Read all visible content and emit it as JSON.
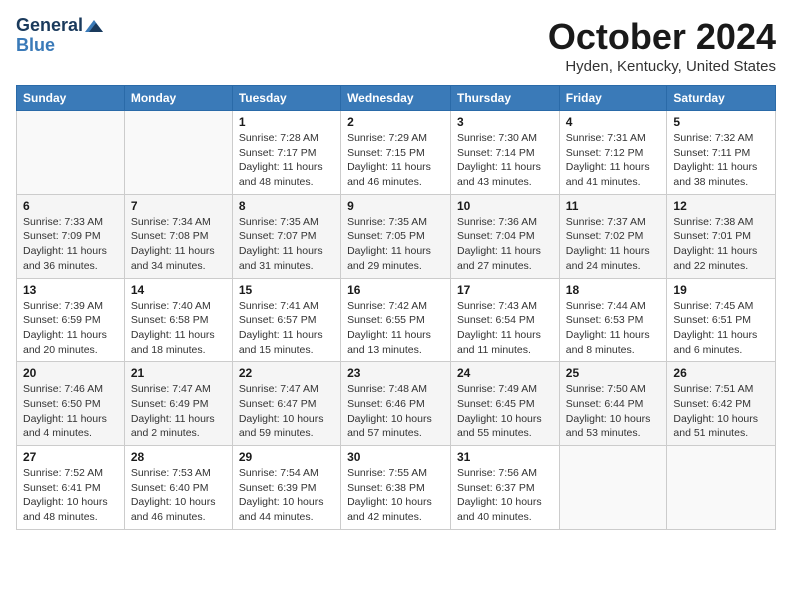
{
  "header": {
    "logo_line1": "General",
    "logo_line2": "Blue",
    "month_title": "October 2024",
    "location": "Hyden, Kentucky, United States"
  },
  "weekdays": [
    "Sunday",
    "Monday",
    "Tuesday",
    "Wednesday",
    "Thursday",
    "Friday",
    "Saturday"
  ],
  "weeks": [
    [
      {
        "day": "",
        "sunrise": "",
        "sunset": "",
        "daylight": ""
      },
      {
        "day": "",
        "sunrise": "",
        "sunset": "",
        "daylight": ""
      },
      {
        "day": "1",
        "sunrise": "Sunrise: 7:28 AM",
        "sunset": "Sunset: 7:17 PM",
        "daylight": "Daylight: 11 hours and 48 minutes."
      },
      {
        "day": "2",
        "sunrise": "Sunrise: 7:29 AM",
        "sunset": "Sunset: 7:15 PM",
        "daylight": "Daylight: 11 hours and 46 minutes."
      },
      {
        "day": "3",
        "sunrise": "Sunrise: 7:30 AM",
        "sunset": "Sunset: 7:14 PM",
        "daylight": "Daylight: 11 hours and 43 minutes."
      },
      {
        "day": "4",
        "sunrise": "Sunrise: 7:31 AM",
        "sunset": "Sunset: 7:12 PM",
        "daylight": "Daylight: 11 hours and 41 minutes."
      },
      {
        "day": "5",
        "sunrise": "Sunrise: 7:32 AM",
        "sunset": "Sunset: 7:11 PM",
        "daylight": "Daylight: 11 hours and 38 minutes."
      }
    ],
    [
      {
        "day": "6",
        "sunrise": "Sunrise: 7:33 AM",
        "sunset": "Sunset: 7:09 PM",
        "daylight": "Daylight: 11 hours and 36 minutes."
      },
      {
        "day": "7",
        "sunrise": "Sunrise: 7:34 AM",
        "sunset": "Sunset: 7:08 PM",
        "daylight": "Daylight: 11 hours and 34 minutes."
      },
      {
        "day": "8",
        "sunrise": "Sunrise: 7:35 AM",
        "sunset": "Sunset: 7:07 PM",
        "daylight": "Daylight: 11 hours and 31 minutes."
      },
      {
        "day": "9",
        "sunrise": "Sunrise: 7:35 AM",
        "sunset": "Sunset: 7:05 PM",
        "daylight": "Daylight: 11 hours and 29 minutes."
      },
      {
        "day": "10",
        "sunrise": "Sunrise: 7:36 AM",
        "sunset": "Sunset: 7:04 PM",
        "daylight": "Daylight: 11 hours and 27 minutes."
      },
      {
        "day": "11",
        "sunrise": "Sunrise: 7:37 AM",
        "sunset": "Sunset: 7:02 PM",
        "daylight": "Daylight: 11 hours and 24 minutes."
      },
      {
        "day": "12",
        "sunrise": "Sunrise: 7:38 AM",
        "sunset": "Sunset: 7:01 PM",
        "daylight": "Daylight: 11 hours and 22 minutes."
      }
    ],
    [
      {
        "day": "13",
        "sunrise": "Sunrise: 7:39 AM",
        "sunset": "Sunset: 6:59 PM",
        "daylight": "Daylight: 11 hours and 20 minutes."
      },
      {
        "day": "14",
        "sunrise": "Sunrise: 7:40 AM",
        "sunset": "Sunset: 6:58 PM",
        "daylight": "Daylight: 11 hours and 18 minutes."
      },
      {
        "day": "15",
        "sunrise": "Sunrise: 7:41 AM",
        "sunset": "Sunset: 6:57 PM",
        "daylight": "Daylight: 11 hours and 15 minutes."
      },
      {
        "day": "16",
        "sunrise": "Sunrise: 7:42 AM",
        "sunset": "Sunset: 6:55 PM",
        "daylight": "Daylight: 11 hours and 13 minutes."
      },
      {
        "day": "17",
        "sunrise": "Sunrise: 7:43 AM",
        "sunset": "Sunset: 6:54 PM",
        "daylight": "Daylight: 11 hours and 11 minutes."
      },
      {
        "day": "18",
        "sunrise": "Sunrise: 7:44 AM",
        "sunset": "Sunset: 6:53 PM",
        "daylight": "Daylight: 11 hours and 8 minutes."
      },
      {
        "day": "19",
        "sunrise": "Sunrise: 7:45 AM",
        "sunset": "Sunset: 6:51 PM",
        "daylight": "Daylight: 11 hours and 6 minutes."
      }
    ],
    [
      {
        "day": "20",
        "sunrise": "Sunrise: 7:46 AM",
        "sunset": "Sunset: 6:50 PM",
        "daylight": "Daylight: 11 hours and 4 minutes."
      },
      {
        "day": "21",
        "sunrise": "Sunrise: 7:47 AM",
        "sunset": "Sunset: 6:49 PM",
        "daylight": "Daylight: 11 hours and 2 minutes."
      },
      {
        "day": "22",
        "sunrise": "Sunrise: 7:47 AM",
        "sunset": "Sunset: 6:47 PM",
        "daylight": "Daylight: 10 hours and 59 minutes."
      },
      {
        "day": "23",
        "sunrise": "Sunrise: 7:48 AM",
        "sunset": "Sunset: 6:46 PM",
        "daylight": "Daylight: 10 hours and 57 minutes."
      },
      {
        "day": "24",
        "sunrise": "Sunrise: 7:49 AM",
        "sunset": "Sunset: 6:45 PM",
        "daylight": "Daylight: 10 hours and 55 minutes."
      },
      {
        "day": "25",
        "sunrise": "Sunrise: 7:50 AM",
        "sunset": "Sunset: 6:44 PM",
        "daylight": "Daylight: 10 hours and 53 minutes."
      },
      {
        "day": "26",
        "sunrise": "Sunrise: 7:51 AM",
        "sunset": "Sunset: 6:42 PM",
        "daylight": "Daylight: 10 hours and 51 minutes."
      }
    ],
    [
      {
        "day": "27",
        "sunrise": "Sunrise: 7:52 AM",
        "sunset": "Sunset: 6:41 PM",
        "daylight": "Daylight: 10 hours and 48 minutes."
      },
      {
        "day": "28",
        "sunrise": "Sunrise: 7:53 AM",
        "sunset": "Sunset: 6:40 PM",
        "daylight": "Daylight: 10 hours and 46 minutes."
      },
      {
        "day": "29",
        "sunrise": "Sunrise: 7:54 AM",
        "sunset": "Sunset: 6:39 PM",
        "daylight": "Daylight: 10 hours and 44 minutes."
      },
      {
        "day": "30",
        "sunrise": "Sunrise: 7:55 AM",
        "sunset": "Sunset: 6:38 PM",
        "daylight": "Daylight: 10 hours and 42 minutes."
      },
      {
        "day": "31",
        "sunrise": "Sunrise: 7:56 AM",
        "sunset": "Sunset: 6:37 PM",
        "daylight": "Daylight: 10 hours and 40 minutes."
      },
      {
        "day": "",
        "sunrise": "",
        "sunset": "",
        "daylight": ""
      },
      {
        "day": "",
        "sunrise": "",
        "sunset": "",
        "daylight": ""
      }
    ]
  ]
}
